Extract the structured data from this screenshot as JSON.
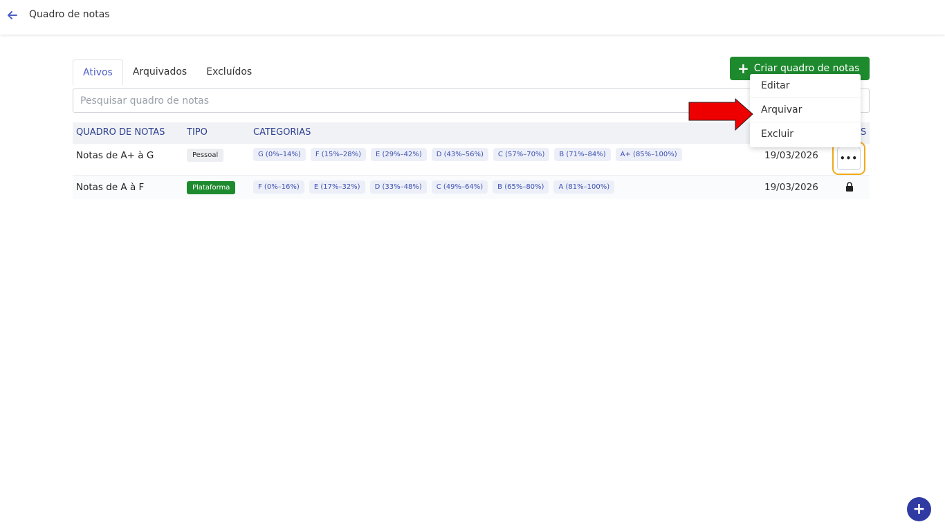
{
  "header": {
    "title": "Quadro de notas",
    "back_icon": "arrow-left-icon"
  },
  "tabs": [
    {
      "label": "Ativos",
      "active": true
    },
    {
      "label": "Arquivados",
      "active": false
    },
    {
      "label": "Excluídos",
      "active": false
    }
  ],
  "create_button": {
    "label": "Criar quadro de notas",
    "icon": "plus-icon"
  },
  "search": {
    "placeholder": "Pesquisar quadro de notas",
    "value": ""
  },
  "table": {
    "columns": {
      "name": "QUADRO DE NOTAS",
      "type": "TIPO",
      "categories": "CATEGORIAS",
      "actions_tail": "S"
    },
    "rows": [
      {
        "name": "Notas de A+ à G",
        "type": "Pessoal",
        "categories": [
          "G (0%–14%)",
          "F (15%–28%)",
          "E (29%–42%)",
          "D (43%–56%)",
          "C (57%–70%)",
          "B (71%–84%)",
          "A+ (85%–100%)"
        ],
        "date": "19/03/2026",
        "action": "more",
        "action_label": "•••"
      },
      {
        "name": "Notas de A à F",
        "type": "Plataforma",
        "categories": [
          "F (0%–16%)",
          "E (17%–32%)",
          "D (33%–48%)",
          "C (49%–64%)",
          "B (65%–80%)",
          "A (81%–100%)"
        ],
        "date": "19/03/2026",
        "action": "lock"
      }
    ]
  },
  "context_menu": {
    "items": [
      "Editar",
      "Arquivar",
      "Excluir"
    ]
  },
  "fab": {
    "label": "+"
  },
  "colors": {
    "accent": "#4b5fc8",
    "green": "#1e8a2e",
    "highlight": "#f0a91a",
    "arrow": "#ee0000",
    "fab": "#2f3aa3"
  }
}
